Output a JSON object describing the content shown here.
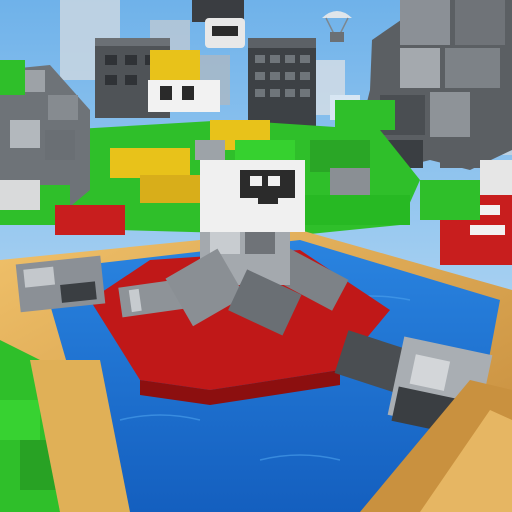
{
  "scene": {
    "type": "voxel-game-render",
    "hud": [],
    "palette": {
      "sky": "#8fc7ef",
      "water": "#1f6fd0",
      "grass": "#2fbf2a",
      "stone": "#7a7a7a",
      "sand": "#e4b45a",
      "red_block": "#c81e1e",
      "yellow_block": "#e8c21a"
    },
    "icons": [
      "blocky-robot-character",
      "stone-giant",
      "floating-drone",
      "parachute-drone"
    ]
  }
}
